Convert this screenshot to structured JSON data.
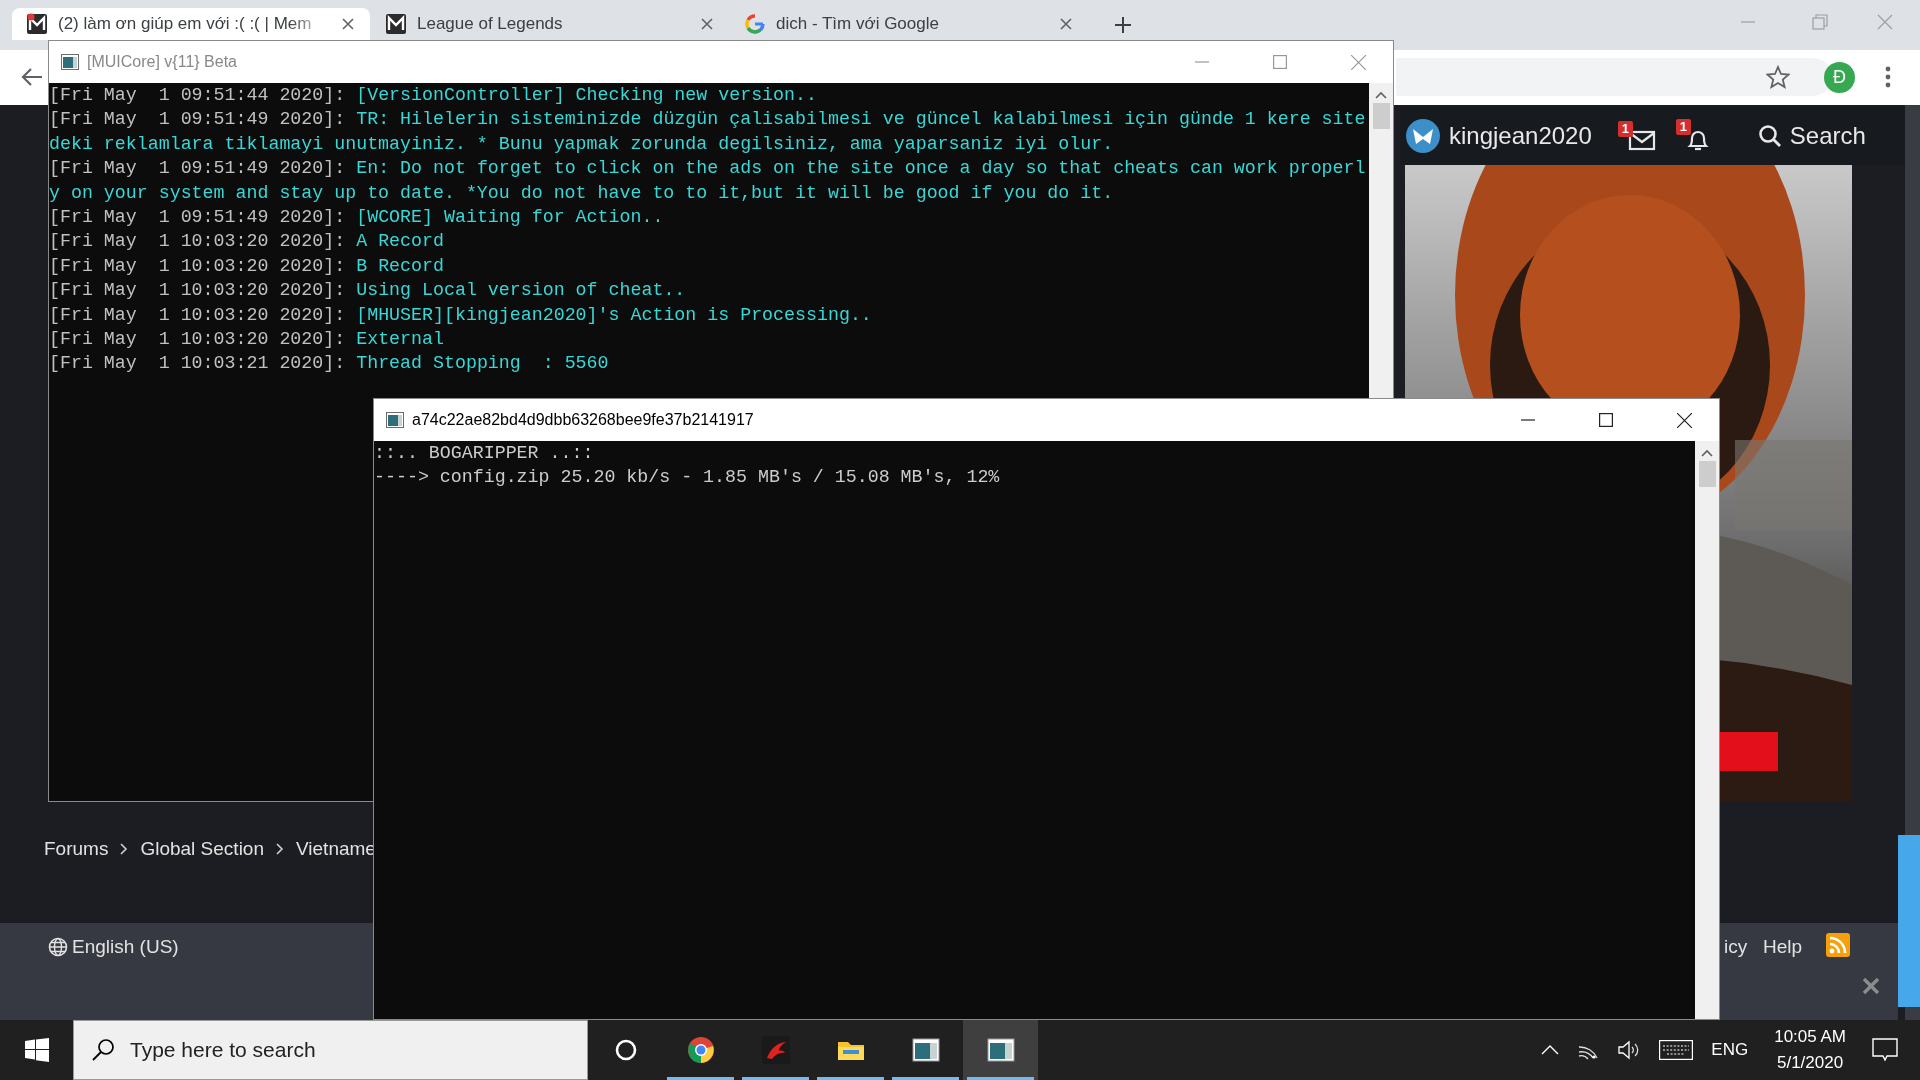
{
  "browser": {
    "tabs": [
      {
        "title": "(2) làm ơn giúp em với :( :( | Mem",
        "selected": true
      },
      {
        "title": "League of Legends",
        "selected": false
      },
      {
        "title": "dich - Tìm với Google",
        "selected": false
      }
    ],
    "profile_initial": "Đ"
  },
  "site": {
    "username": "kingjean2020",
    "messages_badge": "1",
    "alerts_badge": "1",
    "search_label": "Search",
    "breadcrumb": [
      "Forums",
      "Global Section",
      "Vietname"
    ],
    "language": "English (US)",
    "footer_links": [
      "icy",
      "Help"
    ]
  },
  "consoles": [
    {
      "title": "[MUICore] v{11} Beta",
      "active": false,
      "lines": [
        {
          "kind": "entry",
          "time": "[Fri May  1 09:51:44 2020]:",
          "text": "[VersionController] Checking new version.."
        },
        {
          "kind": "entry",
          "time": "[Fri May  1 09:51:49 2020]:",
          "text": "TR: Hilelerin sisteminizde düzgün çalisabilmesi ve güncel kalabilmesi için günde 1 kere site"
        },
        {
          "kind": "wrap",
          "text": "deki reklamlara tiklamayi unutmayiniz. * Bunu yapmak zorunda degilsiniz, ama yaparsaniz iyi olur."
        },
        {
          "kind": "entry",
          "time": "[Fri May  1 09:51:49 2020]:",
          "text": "En: Do not forget to click on the ads on the site once a day so that cheats can work properl"
        },
        {
          "kind": "wrap",
          "text": "y on your system and stay up to date. *You do not have to to it,but it will be good if you do it."
        },
        {
          "kind": "entry",
          "time": "[Fri May  1 09:51:49 2020]:",
          "text": "[WCORE] Waiting for Action.."
        },
        {
          "kind": "entry",
          "time": "[Fri May  1 10:03:20 2020]:",
          "text": "A Record"
        },
        {
          "kind": "entry",
          "time": "[Fri May  1 10:03:20 2020]:",
          "text": "B Record"
        },
        {
          "kind": "entry",
          "time": "[Fri May  1 10:03:20 2020]:",
          "text": "Using Local version of cheat.."
        },
        {
          "kind": "entry",
          "time": "[Fri May  1 10:03:20 2020]:",
          "text": "[MHUSER][kingjean2020]'s Action is Processing.."
        },
        {
          "kind": "entry",
          "time": "[Fri May  1 10:03:20 2020]:",
          "text": "External"
        },
        {
          "kind": "entry",
          "time": "[Fri May  1 10:03:21 2020]:",
          "text": "Thread Stopping  : 5560"
        }
      ]
    },
    {
      "title": "a74c22ae82bd4d9dbb63268bee9fe37b2141917",
      "active": true,
      "lines": [
        {
          "kind": "plain",
          "text": "::.. BOGARIPPER ..::"
        },
        {
          "kind": "plain",
          "text": "----> config.zip 25.20 kb/s - 1.85 MB's / 15.08 MB's, 12%"
        }
      ]
    }
  ],
  "taskbar": {
    "search_placeholder": "Type here to search",
    "apps": [
      {
        "kind": "cortana",
        "running": false,
        "selected": false
      },
      {
        "kind": "chrome",
        "running": true,
        "selected": false
      },
      {
        "kind": "dragon",
        "running": true,
        "selected": false
      },
      {
        "kind": "folder",
        "running": true,
        "selected": false
      },
      {
        "kind": "console",
        "running": true,
        "selected": false
      },
      {
        "kind": "console",
        "running": true,
        "selected": true
      }
    ],
    "language": "ENG",
    "time": "10:05 AM",
    "date": "5/1/2020"
  }
}
